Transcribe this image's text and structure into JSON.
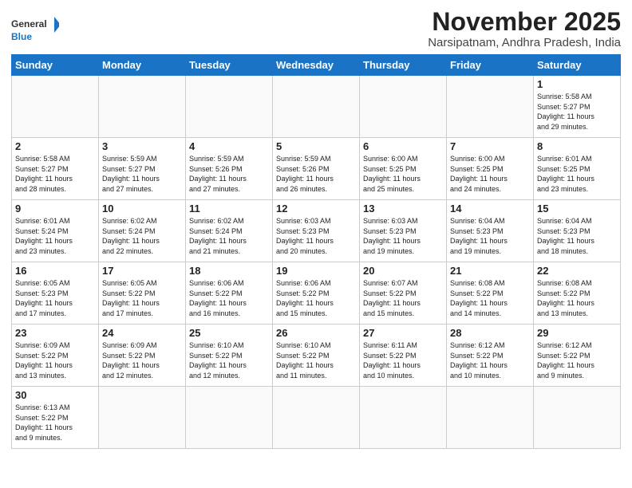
{
  "header": {
    "title": "November 2025",
    "location": "Narsipatnam, Andhra Pradesh, India",
    "logo_general": "General",
    "logo_blue": "Blue"
  },
  "weekdays": [
    "Sunday",
    "Monday",
    "Tuesday",
    "Wednesday",
    "Thursday",
    "Friday",
    "Saturday"
  ],
  "days": [
    {
      "num": "",
      "info": ""
    },
    {
      "num": "",
      "info": ""
    },
    {
      "num": "",
      "info": ""
    },
    {
      "num": "",
      "info": ""
    },
    {
      "num": "",
      "info": ""
    },
    {
      "num": "",
      "info": ""
    },
    {
      "num": "1",
      "info": "Sunrise: 5:58 AM\nSunset: 5:27 PM\nDaylight: 11 hours\nand 29 minutes."
    }
  ],
  "week2": [
    {
      "num": "2",
      "info": "Sunrise: 5:58 AM\nSunset: 5:27 PM\nDaylight: 11 hours\nand 28 minutes."
    },
    {
      "num": "3",
      "info": "Sunrise: 5:59 AM\nSunset: 5:27 PM\nDaylight: 11 hours\nand 27 minutes."
    },
    {
      "num": "4",
      "info": "Sunrise: 5:59 AM\nSunset: 5:26 PM\nDaylight: 11 hours\nand 27 minutes."
    },
    {
      "num": "5",
      "info": "Sunrise: 5:59 AM\nSunset: 5:26 PM\nDaylight: 11 hours\nand 26 minutes."
    },
    {
      "num": "6",
      "info": "Sunrise: 6:00 AM\nSunset: 5:25 PM\nDaylight: 11 hours\nand 25 minutes."
    },
    {
      "num": "7",
      "info": "Sunrise: 6:00 AM\nSunset: 5:25 PM\nDaylight: 11 hours\nand 24 minutes."
    },
    {
      "num": "8",
      "info": "Sunrise: 6:01 AM\nSunset: 5:25 PM\nDaylight: 11 hours\nand 23 minutes."
    }
  ],
  "week3": [
    {
      "num": "9",
      "info": "Sunrise: 6:01 AM\nSunset: 5:24 PM\nDaylight: 11 hours\nand 23 minutes."
    },
    {
      "num": "10",
      "info": "Sunrise: 6:02 AM\nSunset: 5:24 PM\nDaylight: 11 hours\nand 22 minutes."
    },
    {
      "num": "11",
      "info": "Sunrise: 6:02 AM\nSunset: 5:24 PM\nDaylight: 11 hours\nand 21 minutes."
    },
    {
      "num": "12",
      "info": "Sunrise: 6:03 AM\nSunset: 5:23 PM\nDaylight: 11 hours\nand 20 minutes."
    },
    {
      "num": "13",
      "info": "Sunrise: 6:03 AM\nSunset: 5:23 PM\nDaylight: 11 hours\nand 19 minutes."
    },
    {
      "num": "14",
      "info": "Sunrise: 6:04 AM\nSunset: 5:23 PM\nDaylight: 11 hours\nand 19 minutes."
    },
    {
      "num": "15",
      "info": "Sunrise: 6:04 AM\nSunset: 5:23 PM\nDaylight: 11 hours\nand 18 minutes."
    }
  ],
  "week4": [
    {
      "num": "16",
      "info": "Sunrise: 6:05 AM\nSunset: 5:23 PM\nDaylight: 11 hours\nand 17 minutes."
    },
    {
      "num": "17",
      "info": "Sunrise: 6:05 AM\nSunset: 5:22 PM\nDaylight: 11 hours\nand 17 minutes."
    },
    {
      "num": "18",
      "info": "Sunrise: 6:06 AM\nSunset: 5:22 PM\nDaylight: 11 hours\nand 16 minutes."
    },
    {
      "num": "19",
      "info": "Sunrise: 6:06 AM\nSunset: 5:22 PM\nDaylight: 11 hours\nand 15 minutes."
    },
    {
      "num": "20",
      "info": "Sunrise: 6:07 AM\nSunset: 5:22 PM\nDaylight: 11 hours\nand 15 minutes."
    },
    {
      "num": "21",
      "info": "Sunrise: 6:08 AM\nSunset: 5:22 PM\nDaylight: 11 hours\nand 14 minutes."
    },
    {
      "num": "22",
      "info": "Sunrise: 6:08 AM\nSunset: 5:22 PM\nDaylight: 11 hours\nand 13 minutes."
    }
  ],
  "week5": [
    {
      "num": "23",
      "info": "Sunrise: 6:09 AM\nSunset: 5:22 PM\nDaylight: 11 hours\nand 13 minutes."
    },
    {
      "num": "24",
      "info": "Sunrise: 6:09 AM\nSunset: 5:22 PM\nDaylight: 11 hours\nand 12 minutes."
    },
    {
      "num": "25",
      "info": "Sunrise: 6:10 AM\nSunset: 5:22 PM\nDaylight: 11 hours\nand 12 minutes."
    },
    {
      "num": "26",
      "info": "Sunrise: 6:10 AM\nSunset: 5:22 PM\nDaylight: 11 hours\nand 11 minutes."
    },
    {
      "num": "27",
      "info": "Sunrise: 6:11 AM\nSunset: 5:22 PM\nDaylight: 11 hours\nand 10 minutes."
    },
    {
      "num": "28",
      "info": "Sunrise: 6:12 AM\nSunset: 5:22 PM\nDaylight: 11 hours\nand 10 minutes."
    },
    {
      "num": "29",
      "info": "Sunrise: 6:12 AM\nSunset: 5:22 PM\nDaylight: 11 hours\nand 9 minutes."
    }
  ],
  "week6": [
    {
      "num": "30",
      "info": "Sunrise: 6:13 AM\nSunset: 5:22 PM\nDaylight: 11 hours\nand 9 minutes."
    },
    {
      "num": "",
      "info": ""
    },
    {
      "num": "",
      "info": ""
    },
    {
      "num": "",
      "info": ""
    },
    {
      "num": "",
      "info": ""
    },
    {
      "num": "",
      "info": ""
    },
    {
      "num": "",
      "info": ""
    }
  ]
}
